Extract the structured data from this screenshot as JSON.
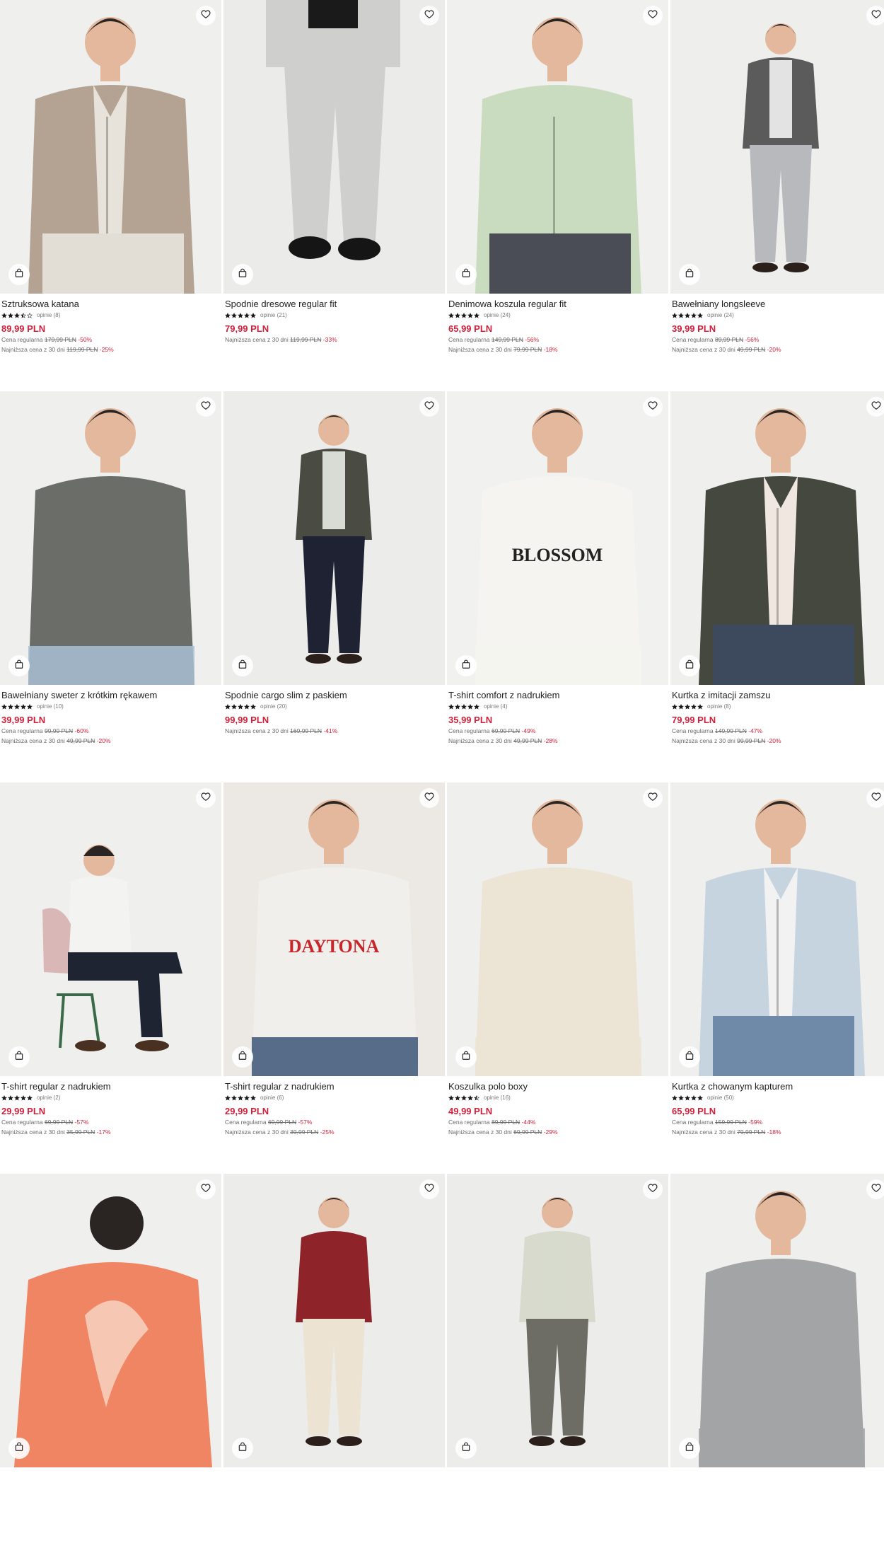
{
  "icons": {
    "wishlist": "heart-icon",
    "add_to_cart": "shopping-bag-icon",
    "rating": "star-icon"
  },
  "colors": {
    "sale": "#d0213b",
    "text": "#1f1f1f",
    "muted": "#6a6a6a"
  },
  "products": [
    {
      "name": "Sztruksowa katana",
      "stars": 3.5,
      "reviews": "opinie (8)",
      "price": "89,99 PLN",
      "regular_label": "Cena regularna",
      "regular_price": "179,99 PLN",
      "regular_discount": "-50%",
      "lowest_label": "Najniższa cena z 30 dni",
      "lowest_price": "119,99 PLN",
      "lowest_discount": "-25%",
      "bg": "#efefed",
      "garment": "#b4a392",
      "garment2": "#e7e3da",
      "pants": "#e2ddd5",
      "pose": "jacket"
    },
    {
      "name": "Spodnie dresowe regular fit",
      "stars": 5,
      "reviews": "opinie (21)",
      "price": "79,99 PLN",
      "regular_label": "",
      "regular_price": "",
      "regular_discount": "",
      "lowest_label": "Najniższa cena z 30 dni",
      "lowest_price": "119,99 PLN",
      "lowest_discount": "-33%",
      "bg": "#ebebea",
      "garment": "#cfcfcd",
      "garment2": "#cfcfcd",
      "pants": "#cfcfcd",
      "pose": "pants"
    },
    {
      "name": "Denimowa koszula regular fit",
      "stars": 5,
      "reviews": "opinie (24)",
      "price": "65,99 PLN",
      "regular_label": "Cena regularna",
      "regular_price": "149,99 PLN",
      "regular_discount": "-56%",
      "lowest_label": "Najniższa cena z 30 dni",
      "lowest_price": "79,99 PLN",
      "lowest_discount": "-18%",
      "bg": "#f0f0ee",
      "garment": "#c9dcbf",
      "garment2": "#c9dcbf",
      "pants": "#4a4d55",
      "pose": "jacket"
    },
    {
      "name": "Bawełniany longsleeve",
      "stars": 5,
      "reviews": "opinie (24)",
      "price": "39,99 PLN",
      "regular_label": "Cena regularna",
      "regular_price": "89,99 PLN",
      "regular_discount": "-56%",
      "lowest_label": "Najniższa cena z 30 dni",
      "lowest_price": "49,99 PLN",
      "lowest_discount": "-20%",
      "bg": "#eeeeed",
      "garment": "#5b5b5b",
      "garment2": "#f2f2f2",
      "pants": "#b7b9bd",
      "pose": "full"
    },
    {
      "name": "Bawełniany sweter z krótkim rękawem",
      "stars": 5,
      "reviews": "opinie (10)",
      "price": "39,99 PLN",
      "regular_label": "Cena regularna",
      "regular_price": "99,99 PLN",
      "regular_discount": "-60%",
      "lowest_label": "Najniższa cena z 30 dni",
      "lowest_price": "49,99 PLN",
      "lowest_discount": "-20%",
      "bg": "#efefee",
      "garment": "#6b6e68",
      "garment2": "#6b6e68",
      "pants": "#a9c0d6",
      "pose": "tee"
    },
    {
      "name": "Spodnie cargo slim z paskiem",
      "stars": 5,
      "reviews": "opinie (20)",
      "price": "99,99 PLN",
      "regular_label": "",
      "regular_price": "",
      "regular_discount": "",
      "lowest_label": "Najniższa cena z 30 dni",
      "lowest_price": "169,99 PLN",
      "lowest_discount": "-41%",
      "bg": "#ececeb",
      "garment": "#4a4c43",
      "garment2": "#e8ece6",
      "pants": "#1e2233",
      "pose": "full"
    },
    {
      "name": "T-shirt comfort z nadrukiem",
      "stars": 5,
      "reviews": "opinie (4)",
      "price": "35,99 PLN",
      "regular_label": "Cena regularna",
      "regular_price": "69,99 PLN",
      "regular_discount": "-49%",
      "lowest_label": "Najniższa cena z 30 dni",
      "lowest_price": "49,99 PLN",
      "lowest_discount": "-28%",
      "bg": "#f1f1ef",
      "garment": "#f5f4f0",
      "garment2": "#f5f4f0",
      "pants": "#f5f4f0",
      "pose": "tee",
      "print": "BLOSSOM"
    },
    {
      "name": "Kurtka z imitacji zamszu",
      "stars": 5,
      "reviews": "opinie (8)",
      "price": "79,99 PLN",
      "regular_label": "Cena regularna",
      "regular_price": "149,99 PLN",
      "regular_discount": "-47%",
      "lowest_label": "Najniższa cena z 30 dni",
      "lowest_price": "99,99 PLN",
      "lowest_discount": "-20%",
      "bg": "#efefee",
      "garment": "#45483f",
      "garment2": "#efe7e0",
      "pants": "#3d4a5e",
      "pose": "jacket"
    },
    {
      "name": "T-shirt regular z nadrukiem",
      "stars": 5,
      "reviews": "opinie (2)",
      "price": "29,99 PLN",
      "regular_label": "Cena regularna",
      "regular_price": "69,99 PLN",
      "regular_discount": "-57%",
      "lowest_label": "Najniższa cena z 30 dni",
      "lowest_price": "35,99 PLN",
      "lowest_discount": "-17%",
      "bg": "#efefee",
      "garment": "#f3f3f1",
      "garment2": "#d9b7b7",
      "pants": "#1f2433",
      "pose": "sit"
    },
    {
      "name": "T-shirt regular z nadrukiem",
      "stars": 5,
      "reviews": "opinie (6)",
      "price": "29,99 PLN",
      "regular_label": "Cena regularna",
      "regular_price": "69,99 PLN",
      "regular_discount": "-57%",
      "lowest_label": "Najniższa cena z 30 dni",
      "lowest_price": "39,99 PLN",
      "lowest_discount": "-25%",
      "bg": "#ece9e5",
      "garment": "#f1efeb",
      "garment2": "#c8262b",
      "pants": "#3b5577",
      "pose": "tee",
      "print": "DAYTONA"
    },
    {
      "name": "Koszulka polo boxy",
      "stars": 4.5,
      "reviews": "opinie (16)",
      "price": "49,99 PLN",
      "regular_label": "Cena regularna",
      "regular_price": "89,99 PLN",
      "regular_discount": "-44%",
      "lowest_label": "Najniższa cena z 30 dni",
      "lowest_price": "69,99 PLN",
      "lowest_discount": "-29%",
      "bg": "#efefee",
      "garment": "#ece5d6",
      "garment2": "#ece5d6",
      "pants": "#ece5d6",
      "pose": "tee"
    },
    {
      "name": "Kurtka z chowanym kapturem",
      "stars": 5,
      "reviews": "opinie (50)",
      "price": "65,99 PLN",
      "regular_label": "Cena regularna",
      "regular_price": "159,99 PLN",
      "regular_discount": "-59%",
      "lowest_label": "Najniższa cena z 30 dni",
      "lowest_price": "79,99 PLN",
      "lowest_discount": "-18%",
      "bg": "#efefee",
      "garment": "#c6d4e0",
      "garment2": "#f2f2f2",
      "pants": "#6f8aa8",
      "pose": "jacket"
    },
    {
      "name": "",
      "stars": 0,
      "reviews": "",
      "price": "",
      "regular_label": "",
      "regular_price": "",
      "regular_discount": "",
      "lowest_label": "",
      "lowest_price": "",
      "lowest_discount": "",
      "bg": "#efefee",
      "garment": "#f08563",
      "garment2": "#f08563",
      "pants": "#f08563",
      "pose": "back"
    },
    {
      "name": "",
      "stars": 0,
      "reviews": "",
      "price": "",
      "regular_label": "",
      "regular_price": "",
      "regular_discount": "",
      "lowest_label": "",
      "lowest_price": "",
      "lowest_discount": "",
      "bg": "#ececeb",
      "garment": "#8e2329",
      "garment2": "#8e2329",
      "pants": "#ece3d2",
      "pose": "full"
    },
    {
      "name": "",
      "stars": 0,
      "reviews": "",
      "price": "",
      "regular_label": "",
      "regular_price": "",
      "regular_discount": "",
      "lowest_label": "",
      "lowest_price": "",
      "lowest_discount": "",
      "bg": "#ececeb",
      "garment": "#d7dacd",
      "garment2": "#d7dacd",
      "pants": "#6d6d66",
      "pose": "full"
    },
    {
      "name": "",
      "stars": 0,
      "reviews": "",
      "price": "",
      "regular_label": "",
      "regular_price": "",
      "regular_discount": "",
      "lowest_label": "",
      "lowest_price": "",
      "lowest_discount": "",
      "bg": "#efefee",
      "garment": "#a3a4a6",
      "garment2": "#a3a4a6",
      "pants": "#a3a4a6",
      "pose": "tee"
    }
  ]
}
